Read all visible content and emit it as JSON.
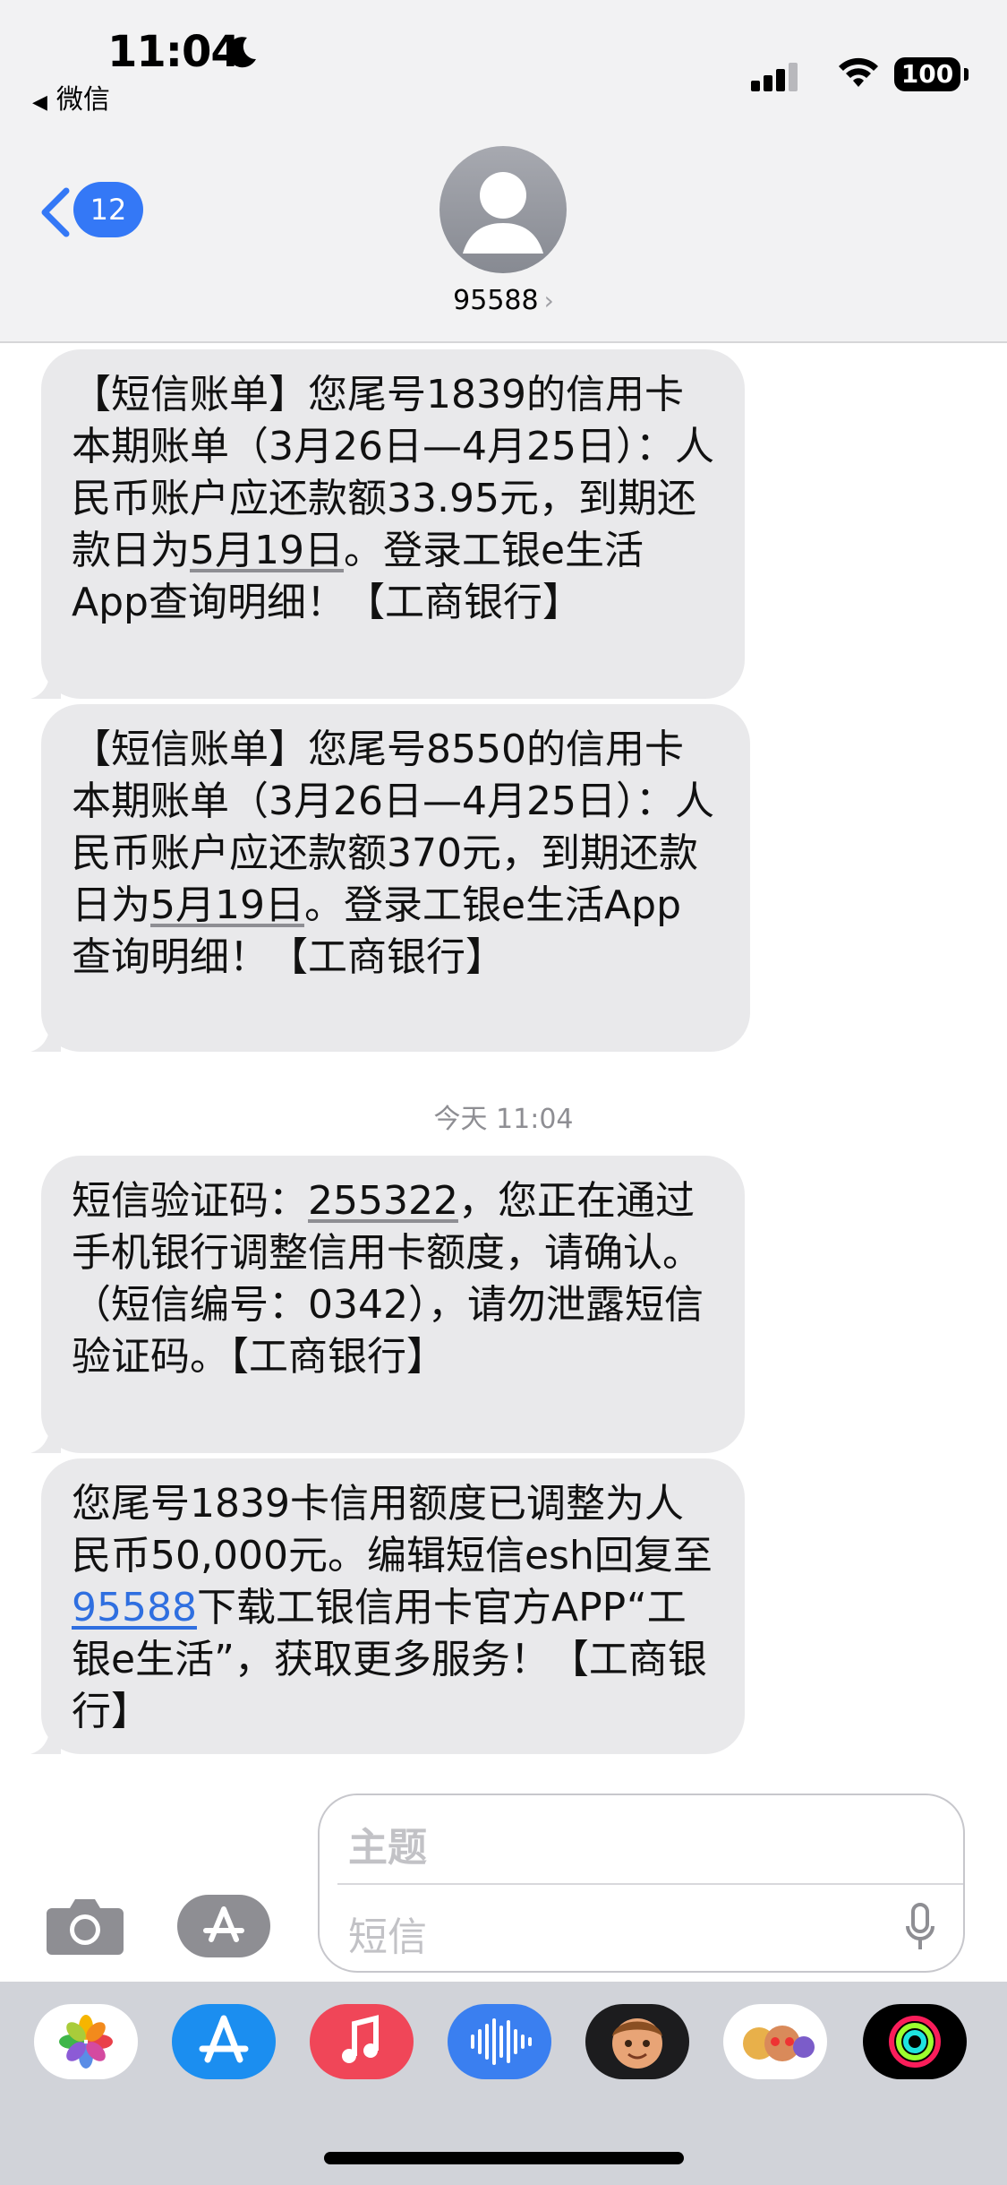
{
  "status_bar": {
    "time": "11:04",
    "back_app": "微信",
    "battery": "100"
  },
  "nav": {
    "unread_count": "12",
    "contact": "95588"
  },
  "messages": [
    {
      "parts": [
        "【短信账单】您尾号1839的信用卡本期账单（3月26日—4月25日）：人民币账户应还款额33.95元，到期还款日为",
        "5月19日",
        "。登录工银e生活App查询明细！【工商银行】"
      ]
    },
    {
      "parts": [
        "【短信账单】您尾号8550的信用卡本期账单（3月26日—4月25日）：人民币账户应还款额370元，到期还款日为",
        "5月19日",
        "。登录工银e生活App查询明细！【工商银行】"
      ]
    },
    {
      "parts": [
        "短信验证码：",
        "255322",
        "，您正在通过手机银行调整信用卡额度，请确认。（短信编号：0342），请勿泄露短信验证码。【工商银行】"
      ]
    },
    {
      "parts": [
        "您尾号1839卡信用额度已调整为人民币50,000元。编辑短信esh回复至",
        "95588",
        "下载工银信用卡官方APP“工银e生活”，获取更多服务！【工商银行】"
      ]
    }
  ],
  "timestamp": {
    "day": "今天",
    "time": "11:04"
  },
  "composer": {
    "subject_placeholder": "主题",
    "message_placeholder": "短信"
  },
  "app_strip": [
    {
      "icon": "photos-icon"
    },
    {
      "icon": "app-store-icon"
    },
    {
      "icon": "music-icon"
    },
    {
      "icon": "audio-message-icon"
    },
    {
      "icon": "memoji-icon"
    },
    {
      "icon": "memoji-stickers-icon"
    },
    {
      "icon": "activity-icon"
    }
  ],
  "colors": {
    "accent": "#3478f6",
    "bubble": "#e9e9eb",
    "link": "#2f6fe0"
  }
}
